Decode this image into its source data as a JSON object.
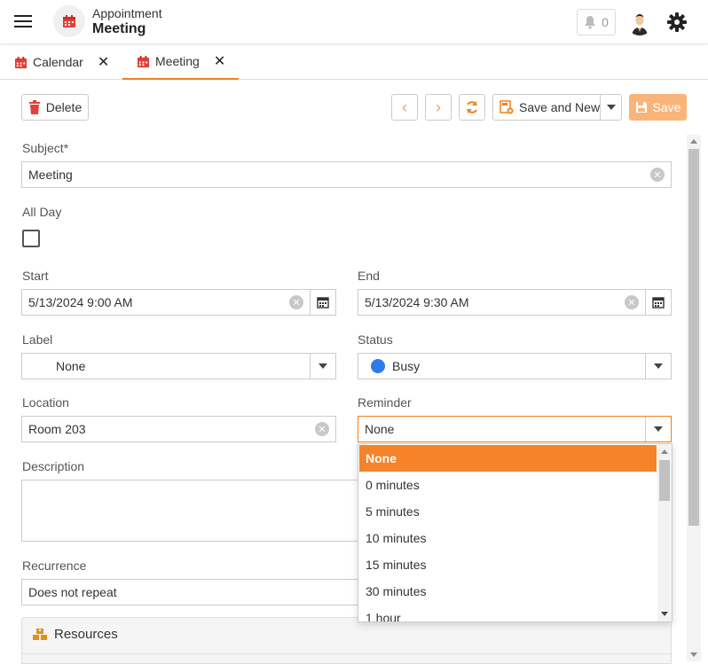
{
  "header": {
    "subtitle": "Appointment",
    "title": "Meeting",
    "notification_count": "0"
  },
  "tabs": [
    {
      "label": "Calendar"
    },
    {
      "label": "Meeting"
    }
  ],
  "toolbar": {
    "delete_label": "Delete",
    "save_and_new_label": "Save and New",
    "save_label": "Save"
  },
  "form": {
    "subject": {
      "label": "Subject*",
      "value": "Meeting"
    },
    "all_day": {
      "label": "All Day",
      "checked": false
    },
    "start": {
      "label": "Start",
      "value": "5/13/2024 9:00 AM"
    },
    "end": {
      "label": "End",
      "value": "5/13/2024 9:30 AM"
    },
    "label_field": {
      "label": "Label",
      "value": "None"
    },
    "status": {
      "label": "Status",
      "value": "Busy",
      "color": "#2f7be9"
    },
    "location": {
      "label": "Location",
      "value": "Room 203"
    },
    "reminder": {
      "label": "Reminder",
      "value": "None"
    },
    "description": {
      "label": "Description",
      "value": ""
    },
    "recurrence": {
      "label": "Recurrence",
      "value": "Does not repeat"
    }
  },
  "resources": {
    "label": "Resources"
  },
  "reminder_options": [
    "None",
    "0 minutes",
    "5 minutes",
    "10 minutes",
    "15 minutes",
    "30 minutes",
    "1 hour"
  ],
  "colors": {
    "accent": "#f0811e",
    "selected": "#f5832a",
    "save_disabled": "#f9b47a",
    "icon_red": "#e0413a"
  }
}
